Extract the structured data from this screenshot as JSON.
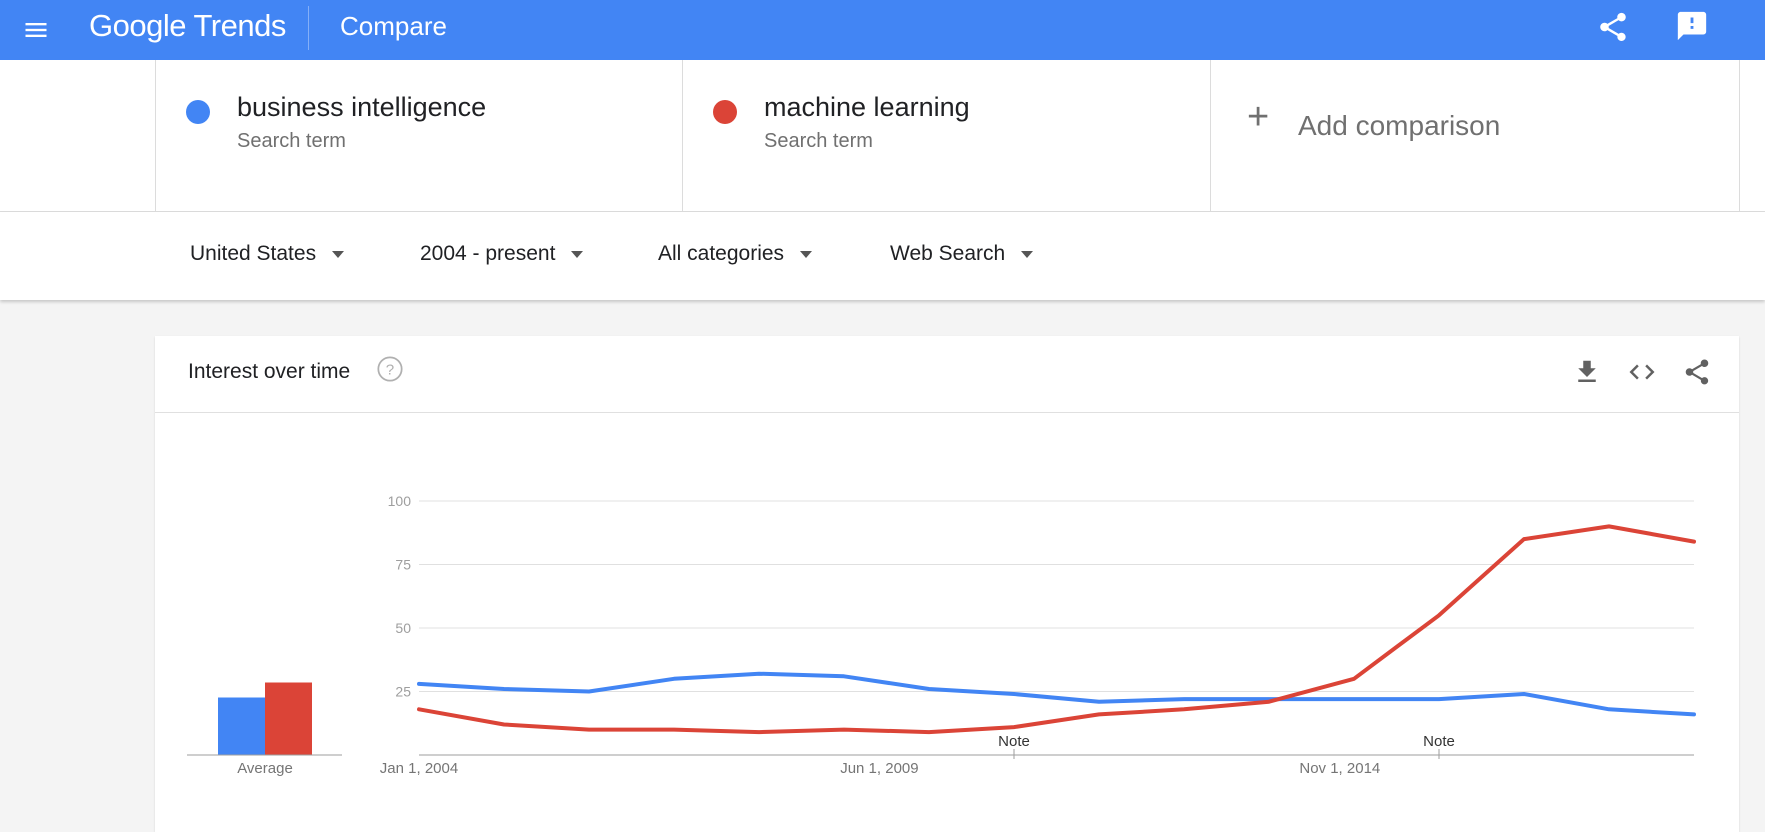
{
  "header": {
    "logo": "Google Trends",
    "page": "Compare",
    "share_icon": "share-icon",
    "feedback_icon": "feedback-icon"
  },
  "terms": [
    {
      "name": "business intelligence",
      "sub": "Search term",
      "color": "#4285f4"
    },
    {
      "name": "machine learning",
      "sub": "Search term",
      "color": "#db4437"
    }
  ],
  "add_comparison": {
    "label": "Add comparison"
  },
  "filters": {
    "region": "United States",
    "time": "2004 - present",
    "category": "All categories",
    "property": "Web Search"
  },
  "card": {
    "title": "Interest over time"
  },
  "chart_data": {
    "type": "line",
    "title": "Interest over time",
    "xlabel": "",
    "ylabel": "",
    "ylim": [
      0,
      100
    ],
    "yticks": [
      25,
      50,
      75,
      100
    ],
    "x_tick_labels": [
      "Jan 1, 2004",
      "Jun 1, 2009",
      "Nov 1, 2014"
    ],
    "x_tick_years": [
      2004.0,
      2009.4167,
      2014.8333
    ],
    "x_range": [
      2004.0,
      2019.0
    ],
    "notes": [
      {
        "label": "Note",
        "x": 2011.0
      },
      {
        "label": "Note",
        "x": 2016.0
      }
    ],
    "x": [
      2004.0,
      2005.0,
      2006.0,
      2007.0,
      2008.0,
      2009.0,
      2010.0,
      2011.0,
      2012.0,
      2013.0,
      2014.0,
      2015.0,
      2016.0,
      2017.0,
      2018.0,
      2019.0
    ],
    "series": [
      {
        "name": "business intelligence",
        "color": "#4285f4",
        "values": [
          28,
          26,
          25,
          30,
          32,
          31,
          26,
          24,
          21,
          22,
          22,
          22,
          22,
          24,
          18,
          16
        ]
      },
      {
        "name": "machine learning",
        "color": "#db4437",
        "values": [
          18,
          12,
          10,
          10,
          9,
          10,
          9,
          11,
          16,
          18,
          21,
          30,
          55,
          85,
          90,
          84
        ]
      }
    ],
    "average": {
      "label": "Average",
      "values": [
        23,
        29
      ]
    }
  }
}
